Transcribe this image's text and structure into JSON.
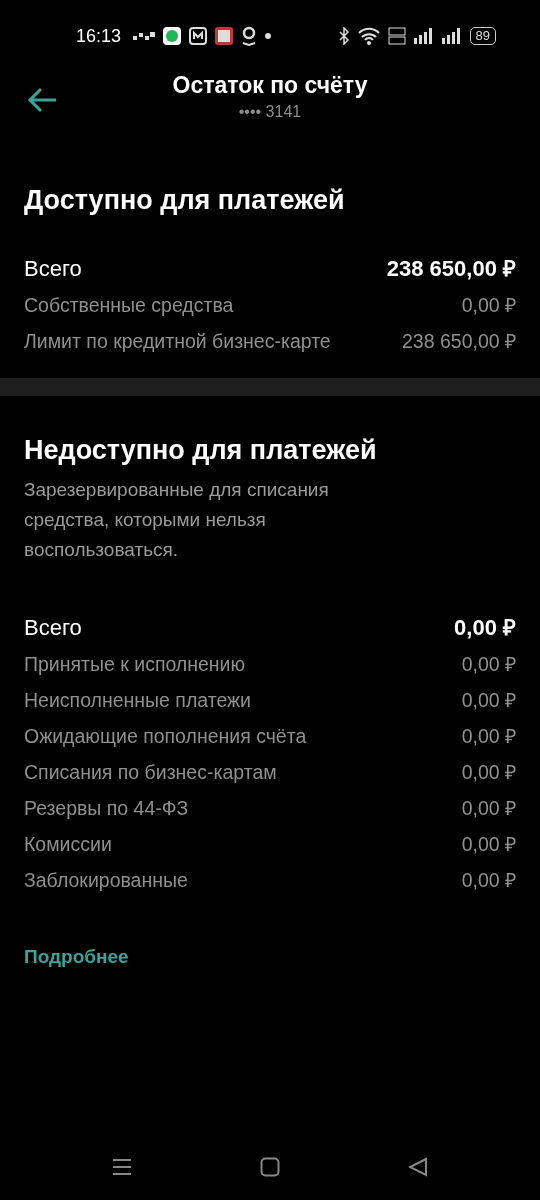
{
  "status_bar": {
    "time": "16:13",
    "battery": "89"
  },
  "header": {
    "title": "Остаток по счёту",
    "account": "•••• 3141"
  },
  "sections": [
    {
      "title": "Доступно для платежей",
      "rows": [
        {
          "kind": "total",
          "label": "Всего",
          "amount": "238 650,00 ₽"
        },
        {
          "kind": "item",
          "label": "Собственные средства",
          "amount": "0,00 ₽"
        },
        {
          "kind": "item",
          "label": "Лимит по кредитной бизнес-карте",
          "amount": "238 650,00 ₽"
        }
      ]
    },
    {
      "title": "Недоступно для платежей",
      "description": "Зарезервированные для списания средства, которыми нельзя воспользоваться.",
      "rows": [
        {
          "kind": "total",
          "label": "Всего",
          "amount": "0,00 ₽"
        },
        {
          "kind": "item",
          "label": "Принятые к исполнению",
          "amount": "0,00 ₽"
        },
        {
          "kind": "item",
          "label": "Неисполненные платежи",
          "amount": "0,00 ₽"
        },
        {
          "kind": "item",
          "label": "Ожидающие пополнения счёта",
          "amount": "0,00 ₽"
        },
        {
          "kind": "item",
          "label": "Списания по бизнес-картам",
          "amount": "0,00 ₽"
        },
        {
          "kind": "item",
          "label": "Резервы по 44-ФЗ",
          "amount": "0,00 ₽"
        },
        {
          "kind": "item",
          "label": "Комиссии",
          "amount": "0,00 ₽"
        },
        {
          "kind": "item",
          "label": "Заблокированные",
          "amount": "0,00 ₽"
        }
      ]
    }
  ],
  "more_link": "Подробнее"
}
